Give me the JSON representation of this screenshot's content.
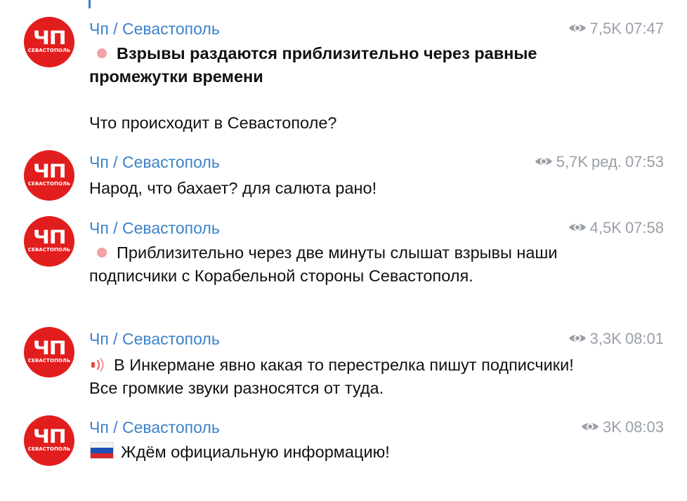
{
  "channel_name": "Чп / Севастополь",
  "avatar": {
    "main": "ЧП",
    "sub": "СЕВАСТОПОЛЬ"
  },
  "posts": [
    {
      "views": "7,5K",
      "edited": "",
      "time": "07:47",
      "marker_icon": "light-red-circle-icon",
      "bold_text": "Взрывы раздаются приблизительно через равные промежутки времени",
      "body_text": "Что происходит в Севастополе?"
    },
    {
      "views": "5,7K",
      "edited": "ред.",
      "time": "07:53",
      "body_text": "Народ, что бахает? для салюта рано!"
    },
    {
      "views": "4,5K",
      "edited": "",
      "time": "07:58",
      "marker_icon": "light-red-circle-icon",
      "body_text": "Приблизительно через две минуты слышат взрывы наши подписчики с Корабельной стороны Севастополя."
    },
    {
      "views": "3,3K",
      "edited": "",
      "time": "08:01",
      "marker_icon": "sound-waves-icon",
      "body_text": "В Инкермане явно какая то перестрелка пишут подписчики! Все громкие звуки разносятся от туда."
    },
    {
      "views": "3K",
      "edited": "",
      "time": "08:03",
      "marker_icon": "russian-flag-icon",
      "body_text": "Ждём официальную информацию!"
    }
  ],
  "colors": {
    "accent": "#3b82c9",
    "avatar_bg": "#e21d1d",
    "meta_gray": "#9aa0a8",
    "marker_dot": "#f1a3a5"
  }
}
